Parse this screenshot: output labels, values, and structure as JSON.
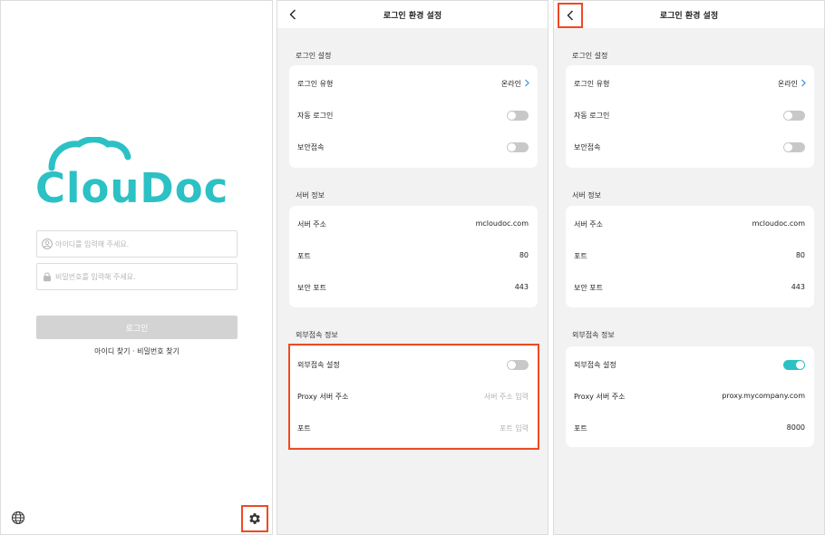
{
  "colors": {
    "brand": "#2cc1c4",
    "highlight": "#ef4a23",
    "disabled_button": "#d3d3d3",
    "toggle_off": "#c8c8c8",
    "toggle_on": "#2cc1c4",
    "link_chevron": "#3a8de0"
  },
  "login": {
    "logo_text": "ClouDoc",
    "id_placeholder": "아이디를 입력해 주세요.",
    "pw_placeholder": "비밀번호를 입력해 주세요.",
    "login_label": "로그인",
    "find_label": "아이디 찾기 · 비밀번호 찾기",
    "icons": {
      "language": "globe-icon",
      "settings": "gear-icon",
      "user": "user-icon",
      "lock": "lock-icon"
    }
  },
  "settings_before": {
    "title": "로그인 환경 설정",
    "sections": {
      "login": {
        "title": "로그인 설정",
        "login_type_label": "로그인 유형",
        "login_type_value": "온라인",
        "auto_login_label": "자동 로그인",
        "auto_login_on": false,
        "secure_conn_label": "보안접속",
        "secure_conn_on": false
      },
      "server": {
        "title": "서버 정보",
        "address_label": "서버 주소",
        "address_value": "mcloudoc.com",
        "port_label": "포트",
        "port_value": "80",
        "secure_port_label": "보안 포트",
        "secure_port_value": "443"
      },
      "external": {
        "title": "외부접속 정보",
        "setting_label": "외부접속 설정",
        "setting_on": false,
        "proxy_label": "Proxy 서버 주소",
        "proxy_placeholder": "서버 주소 입력",
        "port_label": "포트",
        "port_placeholder": "포트 입력"
      }
    }
  },
  "settings_after": {
    "title": "로그인 환경 설정",
    "sections": {
      "login": {
        "title": "로그인 설정",
        "login_type_label": "로그인 유형",
        "login_type_value": "온라인",
        "auto_login_label": "자동 로그인",
        "auto_login_on": false,
        "secure_conn_label": "보안접속",
        "secure_conn_on": false
      },
      "server": {
        "title": "서버 정보",
        "address_label": "서버 주소",
        "address_value": "mcloudoc.com",
        "port_label": "포트",
        "port_value": "80",
        "secure_port_label": "보안 포트",
        "secure_port_value": "443"
      },
      "external": {
        "title": "외부접속 정보",
        "setting_label": "외부접속 설정",
        "setting_on": true,
        "proxy_label": "Proxy 서버 주소",
        "proxy_value": "proxy.mycompany.com",
        "port_label": "포트",
        "port_value": "8000"
      }
    }
  }
}
